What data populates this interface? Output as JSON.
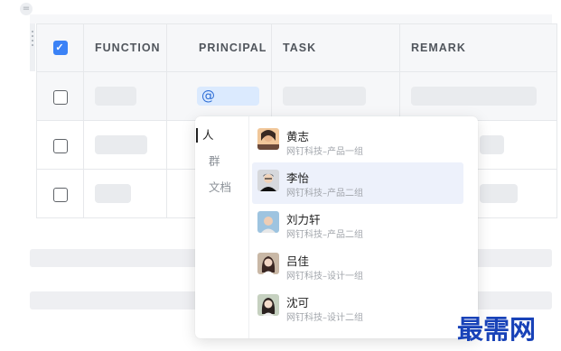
{
  "table": {
    "headers": {
      "function": "FUNCTION",
      "principal": "PRINCIPAL",
      "task": "TASK",
      "remark": "REMARK"
    },
    "header_checked": true,
    "rows": [
      {
        "checked": false,
        "principal_value": "@"
      },
      {
        "checked": false
      },
      {
        "checked": false
      }
    ]
  },
  "mention_popup": {
    "tabs": [
      {
        "label": "人",
        "active": true
      },
      {
        "label": "群",
        "active": false
      },
      {
        "label": "文档",
        "active": false
      }
    ],
    "people": [
      {
        "name": "黄志",
        "org": "网钉科技–产品一组",
        "highlighted": false
      },
      {
        "name": "李怡",
        "org": "网钉科技–产品二组",
        "highlighted": true
      },
      {
        "name": "刘力轩",
        "org": "网钉科技–产品二组",
        "highlighted": false
      },
      {
        "name": "吕佳",
        "org": "网钉科技–设计一组",
        "highlighted": false
      },
      {
        "name": "沈可",
        "org": "网钉科技–设计二组",
        "highlighted": false
      }
    ]
  },
  "watermark": "最需网",
  "colors": {
    "accent": "#3b82f6",
    "highlight": "#edf1fb",
    "watermark": "#1842b8"
  }
}
